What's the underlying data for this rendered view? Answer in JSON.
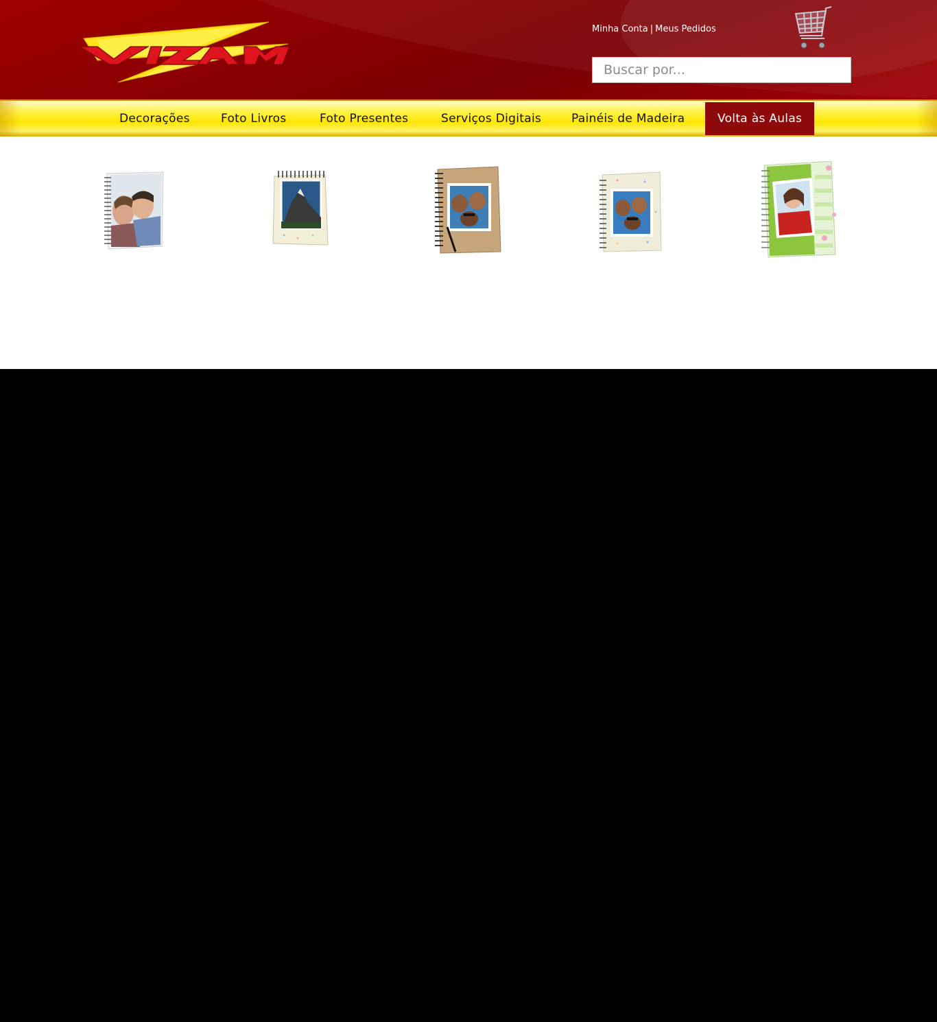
{
  "header": {
    "logo_text": "VIZAM",
    "account_link": "Minha Conta",
    "separator": "|",
    "orders_link": "Meus Pedidos",
    "search_placeholder": "Buscar por...",
    "cart_icon": "shopping-cart-icon"
  },
  "nav": {
    "items": [
      {
        "label": "Decorações"
      },
      {
        "label": "Foto Livros"
      },
      {
        "label": "Foto Presentes"
      },
      {
        "label": "Serviços Digitais"
      },
      {
        "label": "Painéis de Madeira"
      },
      {
        "label": "Volta às Aulas"
      }
    ],
    "active_index": 5
  },
  "products": [
    {
      "name": "notebook-couple"
    },
    {
      "name": "notebook-mountain"
    },
    {
      "name": "notebook-kraft-friends"
    },
    {
      "name": "notebook-dots-friends"
    },
    {
      "name": "notebook-green-girl"
    }
  ],
  "colors": {
    "header_red": "#8a0002",
    "nav_yellow": "#ffe600",
    "active_red": "#8e0a0a"
  }
}
